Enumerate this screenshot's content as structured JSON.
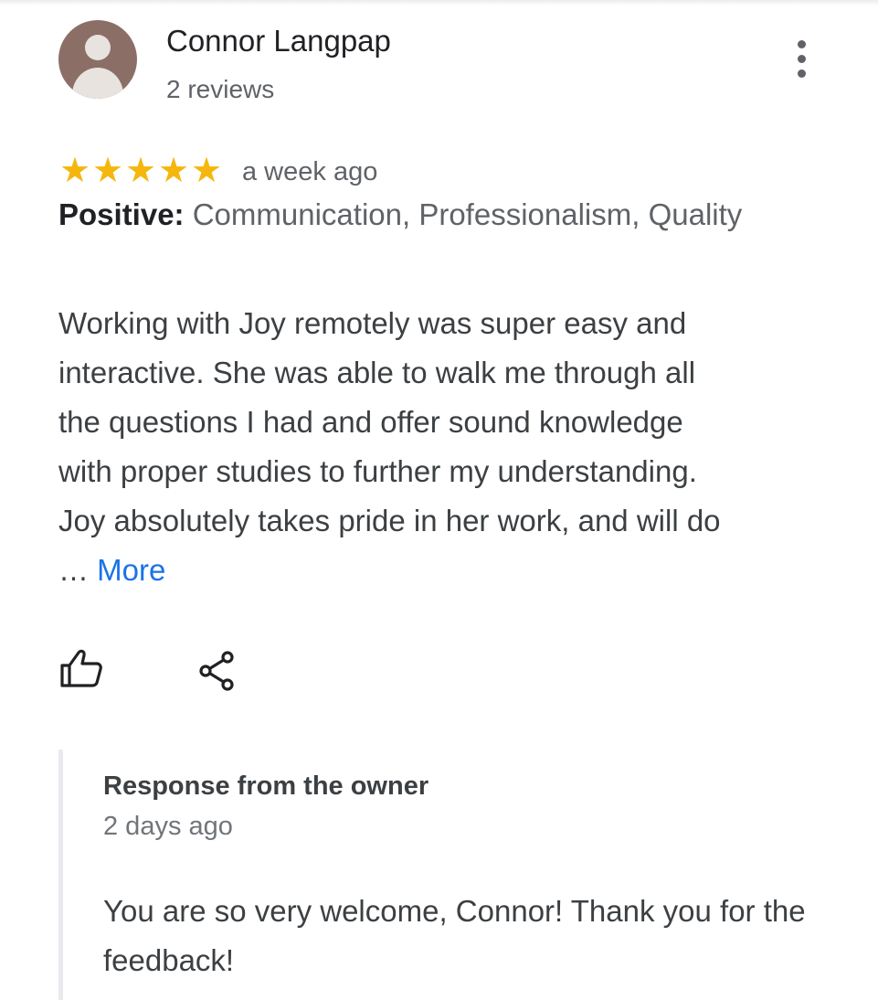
{
  "review": {
    "author_name": "Connor Langpap",
    "author_reviews": "2 reviews",
    "rating": 5,
    "max_rating": 5,
    "stars": [
      "★",
      "★",
      "★",
      "★",
      "★"
    ],
    "time": "a week ago",
    "positive_label": "Positive:",
    "positive_values": "Communication, Professionalism, Quality",
    "text": "Working with Joy remotely was super easy and interactive. She was able to walk me through all the questions I had and offer sound knowledge with proper studies to further my understanding. Joy absolutely takes pride in her work, and will do …",
    "more_label": "More"
  },
  "actions": {
    "like_icon": "thumbs-up-icon",
    "share_icon": "share-icon",
    "menu_icon": "more-vert-icon"
  },
  "owner_response": {
    "title": "Response from the owner",
    "time": "2 days ago",
    "text": "You are so very welcome, Connor! Thank you for the feedback!"
  },
  "colors": {
    "star": "#f5b60d",
    "link": "#1a73e8",
    "avatar_bg": "#8b6f66"
  }
}
